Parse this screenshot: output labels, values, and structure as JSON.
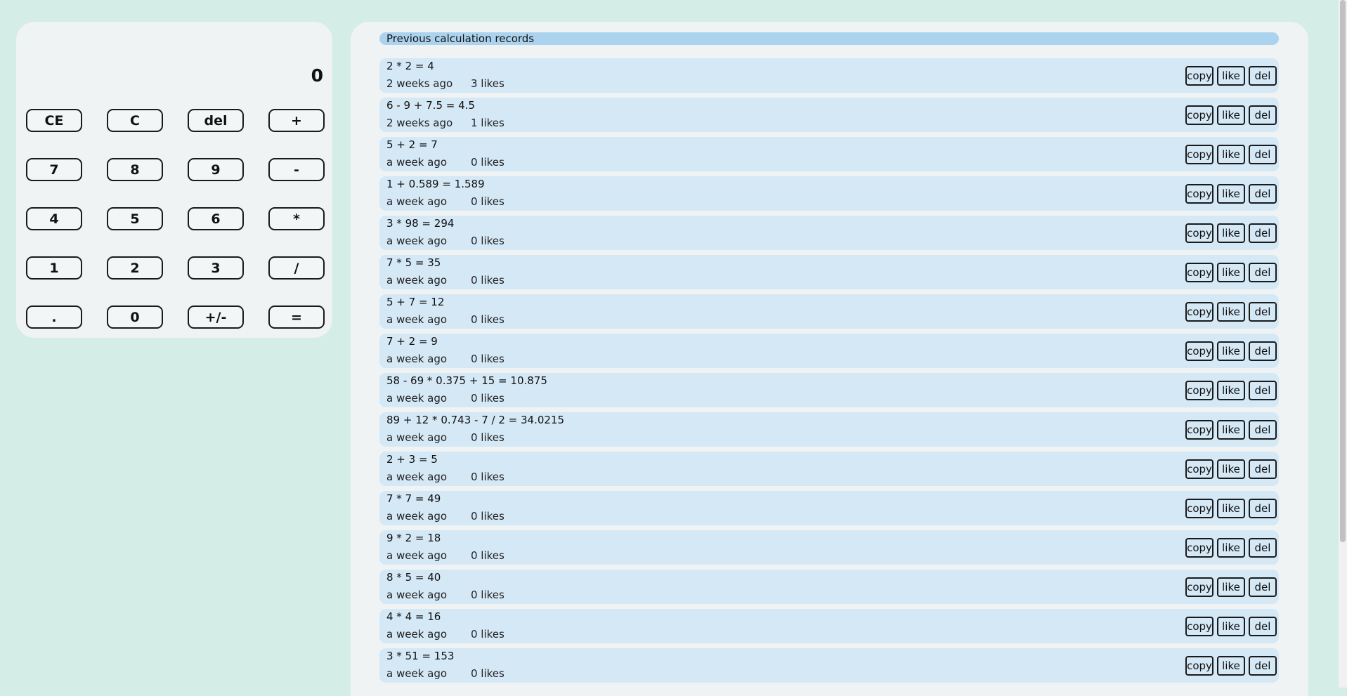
{
  "calculator": {
    "display": "0",
    "keys": [
      {
        "label": "CE",
        "name": "key-clear-entry"
      },
      {
        "label": "C",
        "name": "key-clear"
      },
      {
        "label": "del",
        "name": "key-delete"
      },
      {
        "label": "+",
        "name": "key-plus"
      },
      {
        "label": "7",
        "name": "key-7"
      },
      {
        "label": "8",
        "name": "key-8"
      },
      {
        "label": "9",
        "name": "key-9"
      },
      {
        "label": "-",
        "name": "key-minus"
      },
      {
        "label": "4",
        "name": "key-4"
      },
      {
        "label": "5",
        "name": "key-5"
      },
      {
        "label": "6",
        "name": "key-6"
      },
      {
        "label": "*",
        "name": "key-multiply"
      },
      {
        "label": "1",
        "name": "key-1"
      },
      {
        "label": "2",
        "name": "key-2"
      },
      {
        "label": "3",
        "name": "key-3"
      },
      {
        "label": "/",
        "name": "key-divide"
      },
      {
        "label": ".",
        "name": "key-decimal"
      },
      {
        "label": "0",
        "name": "key-0"
      },
      {
        "label": "+/-",
        "name": "key-negate"
      },
      {
        "label": "=",
        "name": "key-equals"
      }
    ]
  },
  "history": {
    "title": "Previous calculation records",
    "actions": {
      "copy": "copy",
      "like": "like",
      "del": "del"
    },
    "records": [
      {
        "expr": "2 * 2 = 4",
        "time": "2 weeks ago",
        "likes": "3 likes"
      },
      {
        "expr": "6 - 9 + 7.5 = 4.5",
        "time": "2 weeks ago",
        "likes": "1 likes"
      },
      {
        "expr": "5 + 2 = 7",
        "time": "a week ago",
        "likes": "0 likes"
      },
      {
        "expr": "1 + 0.589 = 1.589",
        "time": "a week ago",
        "likes": "0 likes"
      },
      {
        "expr": "3 * 98 = 294",
        "time": "a week ago",
        "likes": "0 likes"
      },
      {
        "expr": "7 * 5 = 35",
        "time": "a week ago",
        "likes": "0 likes"
      },
      {
        "expr": "5 + 7 = 12",
        "time": "a week ago",
        "likes": "0 likes"
      },
      {
        "expr": "7 + 2 = 9",
        "time": "a week ago",
        "likes": "0 likes"
      },
      {
        "expr": "58 - 69 * 0.375 + 15 = 10.875",
        "time": "a week ago",
        "likes": "0 likes"
      },
      {
        "expr": "89 + 12 * 0.743 - 7 / 2 = 34.0215",
        "time": "a week ago",
        "likes": "0 likes"
      },
      {
        "expr": "2 + 3 = 5",
        "time": "a week ago",
        "likes": "0 likes"
      },
      {
        "expr": "7 * 7 = 49",
        "time": "a week ago",
        "likes": "0 likes"
      },
      {
        "expr": "9 * 2 = 18",
        "time": "a week ago",
        "likes": "0 likes"
      },
      {
        "expr": "8 * 5 = 40",
        "time": "a week ago",
        "likes": "0 likes"
      },
      {
        "expr": "4 * 4 = 16",
        "time": "a week ago",
        "likes": "0 likes"
      },
      {
        "expr": "3 * 51 = 153",
        "time": "a week ago",
        "likes": "0 likes"
      }
    ]
  }
}
